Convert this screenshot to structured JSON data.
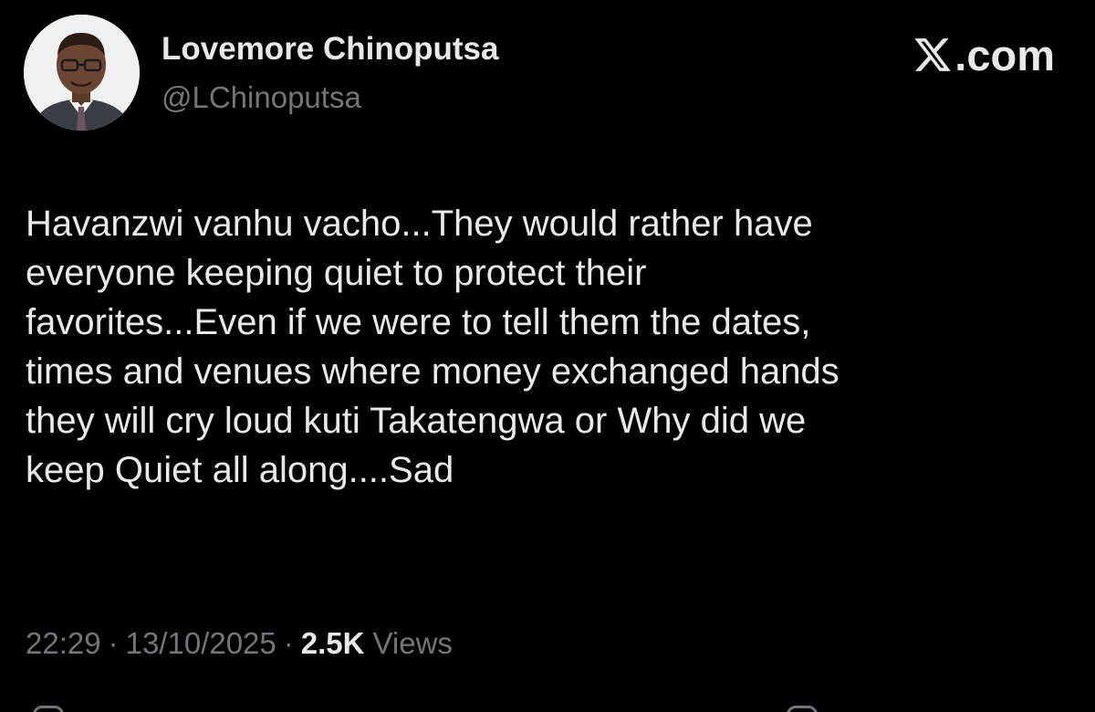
{
  "author": {
    "display_name": "Lovemore Chinoputsa",
    "handle": "@LChinoputsa",
    "avatar_icon": "profile-photo"
  },
  "brand": {
    "label": ".com",
    "icon": "x-logo-icon"
  },
  "tweet": {
    "lines": [
      "Havanzwi vanhu vacho...They would rather have",
      "everyone keeping quiet to protect their",
      "favorites...Even if we were to tell them the dates,",
      "times and venues where money exchanged hands",
      "they will cry loud kuti Takatengwa or Why did we",
      "keep Quiet all along....Sad"
    ]
  },
  "meta": {
    "time": "22:29",
    "separator": "·",
    "date": "13/10/2025",
    "views_count": "2.5K",
    "views_label": "Views"
  },
  "colors": {
    "background": "#000000",
    "primary_text": "#e7e9ea",
    "secondary_text": "#71767b"
  }
}
